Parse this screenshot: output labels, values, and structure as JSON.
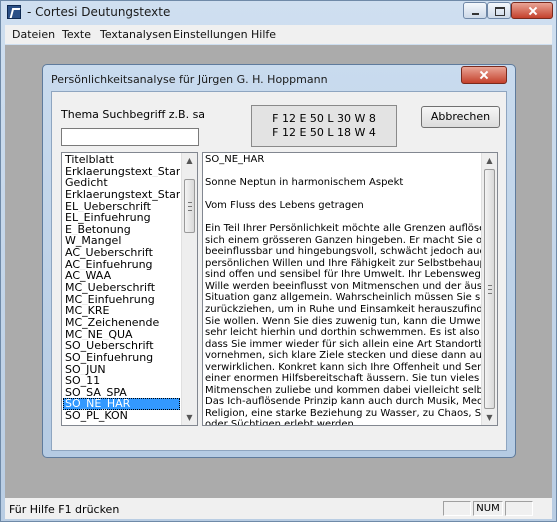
{
  "app": {
    "title": "- Cortesi Deutungstexte"
  },
  "menu": [
    "Dateien",
    "Texte",
    "Textanalysen",
    "Einstellungen",
    "Hilfe"
  ],
  "status": {
    "text": "Für Hilfe F1 drücken",
    "num": "NUM"
  },
  "dialog": {
    "title": "Persönlichkeitsanalyse für Jürgen G. H. Hoppmann",
    "search_label": "Thema Suchbegriff z.B. sa",
    "search_value": "",
    "info_lines": [
      "F 12 E 50 L 30 W  8",
      "F 12 E 50 L 18 W  4"
    ],
    "cancel_label": "Abbrechen",
    "list_items": [
      "Titelblatt",
      "Erklaerungstext_Standarda",
      "Gedicht",
      "Erklaerungstext_Standarda",
      "EL_Ueberschrift",
      "EL_Einfuehrung",
      "E_Betonung",
      "W_Mangel",
      "AC_Ueberschrift",
      "AC_Einfuehrung",
      "AC_WAA",
      "MC_Ueberschrift",
      "MC_Einfuehrung",
      "MC_KRE",
      "MC_Zeichenende",
      "MC_NE_QUA",
      "SO_Ueberschrift",
      "SO_Einfuehrung",
      "SO_JUN",
      "SO_11",
      "SO_SA_SPA",
      "SO_NE_HAR",
      "SO_PL_KON"
    ],
    "selected_index": 21,
    "text_paragraphs": [
      [
        "SO_NE_HAR"
      ],
      [
        "Sonne Neptun in harmonischem Aspekt"
      ],
      [
        "Vom Fluss des Lebens getragen"
      ],
      [
        "Ein Teil Ihrer Persönlichkeit möchte alle Grenzen auflösen und",
        "sich einem grösseren Ganzen hingeben. Er macht Sie offen,",
        "beeinflussbar und hingebungsvoll, schwächt jedoch auch Ihren",
        "persönlichen Willen und Ihre Fähigkeit zur Selbstbehauptung. Sie",
        "sind offen und sensibel für Ihre Umwelt. Ihr Lebensweg und Ihr",
        "Wille werden beeinflusst von Mitmenschen und der äusseren",
        "Situation ganz allgemein. Wahrscheinlich müssen Sie sich",
        "zurückziehen, um in Ruhe und Einsamkeit herauszufinden, was",
        "Sie wollen. Wenn Sie dies zuwenig tun, kann die Umwelt Sie",
        "sehr leicht hierhin und dorthin schwemmen. Es ist also wichtig,",
        "dass Sie immer wieder für sich allein eine Art Standortbestimmung",
        "vornehmen, sich klare Ziele stecken und diese dann auch",
        "verwirklichen. Konkret kann sich Ihre Offenheit und Sensibilität in",
        "einer enormen Hilfsbereitschaft äussern. Sie tun vieles Ihren",
        "Mitmenschen zuliebe und kommen dabei vielleicht selbst zu kurz.",
        "Das Ich-auflösende Prinzip kann auch durch Musik, Meditation,",
        "Religion, eine starke Beziehung zu Wasser, zu Chaos, Sucht",
        "oder Süchtigen erlebt werden."
      ]
    ]
  }
}
